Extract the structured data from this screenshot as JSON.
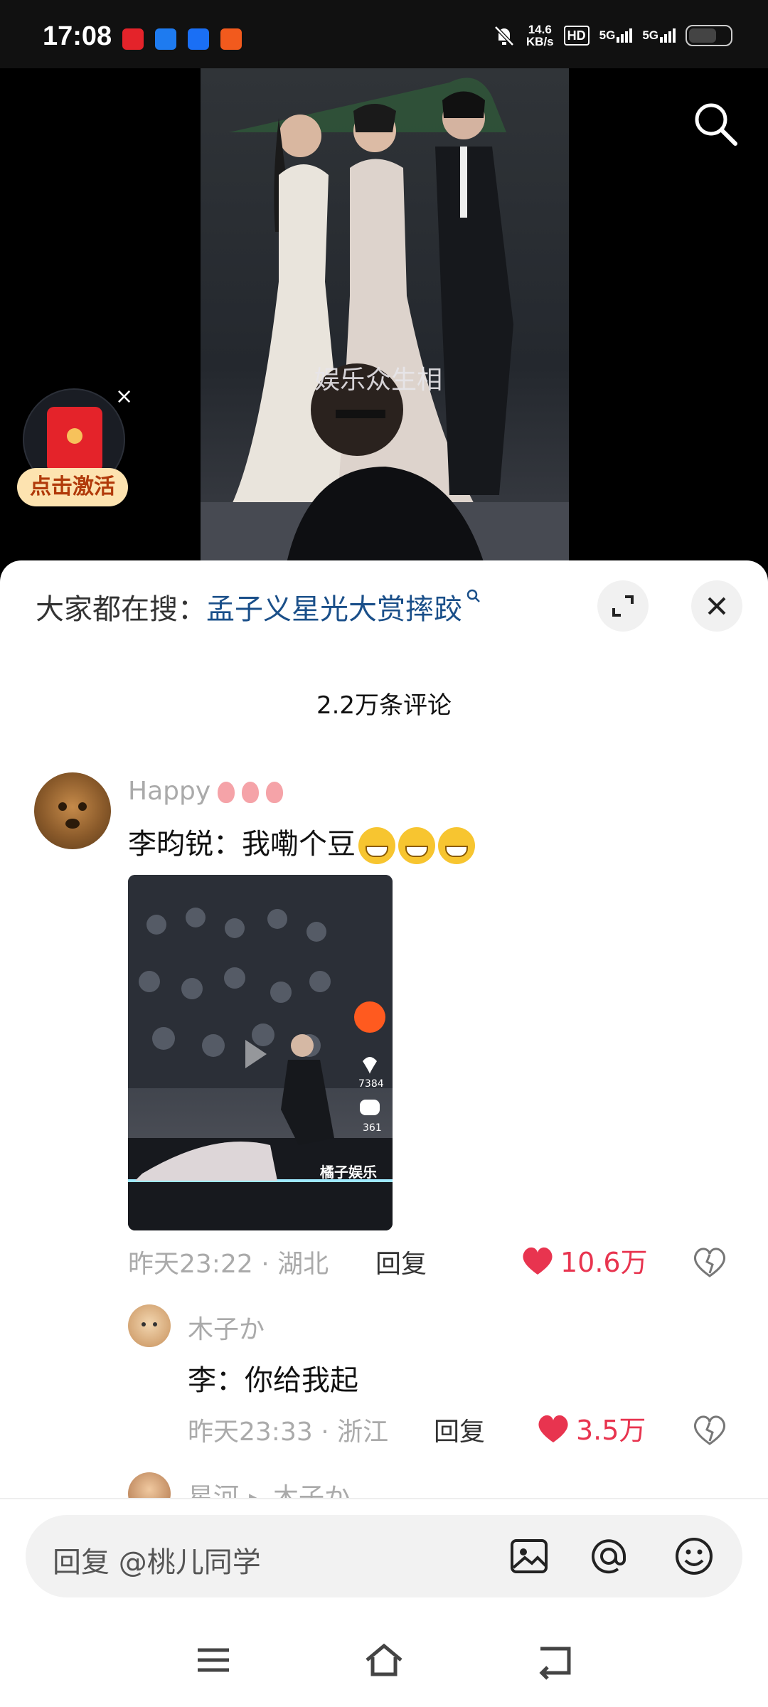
{
  "status_bar": {
    "time": "17:08",
    "net_speed_value": "14.6",
    "net_speed_unit": "KB/s",
    "hd_label": "HD",
    "sim1": "5G",
    "sim2": "5G"
  },
  "video": {
    "watermark": "娱乐众生相",
    "search_icon": "search-icon"
  },
  "red_packet": {
    "button_label": "点击激活",
    "close_label": "×"
  },
  "sheet": {
    "hot_search_prefix": "大家都在搜：",
    "hot_search_link": "孟子义星光大赏摔跤",
    "comment_count": "2.2万条评论"
  },
  "comments": [
    {
      "user": "Happy",
      "text": "李昀锐：我嘞个豆",
      "thumb_likes": "7384",
      "thumb_comments": "361",
      "thumb_watermark": "橘子娱乐",
      "time": "昨天23:22 · 湖北",
      "reply_label": "回复",
      "likes": "10.6万"
    },
    {
      "user": "木子か",
      "text": "李：你给我起",
      "time": "昨天23:33 · 浙江",
      "reply_label": "回复",
      "likes": "3.5万"
    },
    {
      "user": "星河",
      "reply_to": "木子か"
    }
  ],
  "input_bar": {
    "placeholder": "回复 @桃儿同学"
  },
  "colors": {
    "accent_like": "#e8344f",
    "hot_search_link": "#1a4f89",
    "red_packet_button": "#fde3b0"
  }
}
